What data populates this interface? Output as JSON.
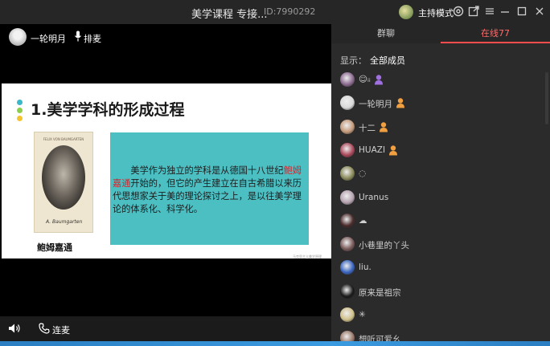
{
  "window": {
    "title": "美学课程 专接...",
    "room_id": "ID:7990292",
    "host_mode_label": "主持模式"
  },
  "video": {
    "presenter_name": "一轮明月",
    "mic_label": "排麦"
  },
  "slide": {
    "title": "1.美学学科的形成过程",
    "dot_colors": [
      "#3cb7c8",
      "#8ccf4d",
      "#f4c430"
    ],
    "portrait_caption": "FELIX VON BAUMGARTEN",
    "portrait_signature": "A. Baumgarten",
    "portrait_name": "鲍姆嘉通",
    "text_before": "美学作为独立的学科是从德国十八世纪",
    "text_highlight": "鲍姆嘉通",
    "text_after": "开始的，但它的产生建立在自古希腊以来历代思想家关于美的理论探讨之上，是以往美学理论的体系化、科学化。",
    "highlight_color": "#d8232a",
    "box_color": "#4cbfc3",
    "footnote": "马克思主义美学原理"
  },
  "bottom_bar": {
    "connect_label": "连麦"
  },
  "panel": {
    "tabs": {
      "chat": "群聊",
      "online": "在线77"
    },
    "filter_label": "显示：",
    "filter_value": "全部成员",
    "members": [
      {
        "name": "☺ᵢᵢ",
        "badge": "purple",
        "avatar": "#8b6a8f"
      },
      {
        "name": "一轮明月",
        "badge": "orange",
        "avatar": "#d9d9d9"
      },
      {
        "name": "十二",
        "badge": "orange",
        "avatar": "#c49a7a"
      },
      {
        "name": "HUAZI",
        "badge": "orange",
        "avatar": "#a8485a"
      },
      {
        "name": "◌",
        "badge": "",
        "avatar": "#8a8a5a"
      },
      {
        "name": "Uranus",
        "badge": "",
        "avatar": "#b5a3b0"
      },
      {
        "name": "☁",
        "badge": "",
        "avatar": "#4a2b2b"
      },
      {
        "name": "小巷里的丫头",
        "badge": "",
        "avatar": "#7a5a5a"
      },
      {
        "name": "liu.",
        "badge": "",
        "avatar": "#3a66c0"
      },
      {
        "name": "原来是祖宗",
        "badge": "",
        "avatar": "#1a1a1a"
      },
      {
        "name": "✳",
        "badge": "",
        "avatar": "#cfc08a"
      },
      {
        "name": "想听可爱幺",
        "badge": "",
        "avatar": "#9a7a6a"
      }
    ],
    "badge_colors": {
      "orange": "#f0a040",
      "purple": "#a070e0"
    }
  }
}
